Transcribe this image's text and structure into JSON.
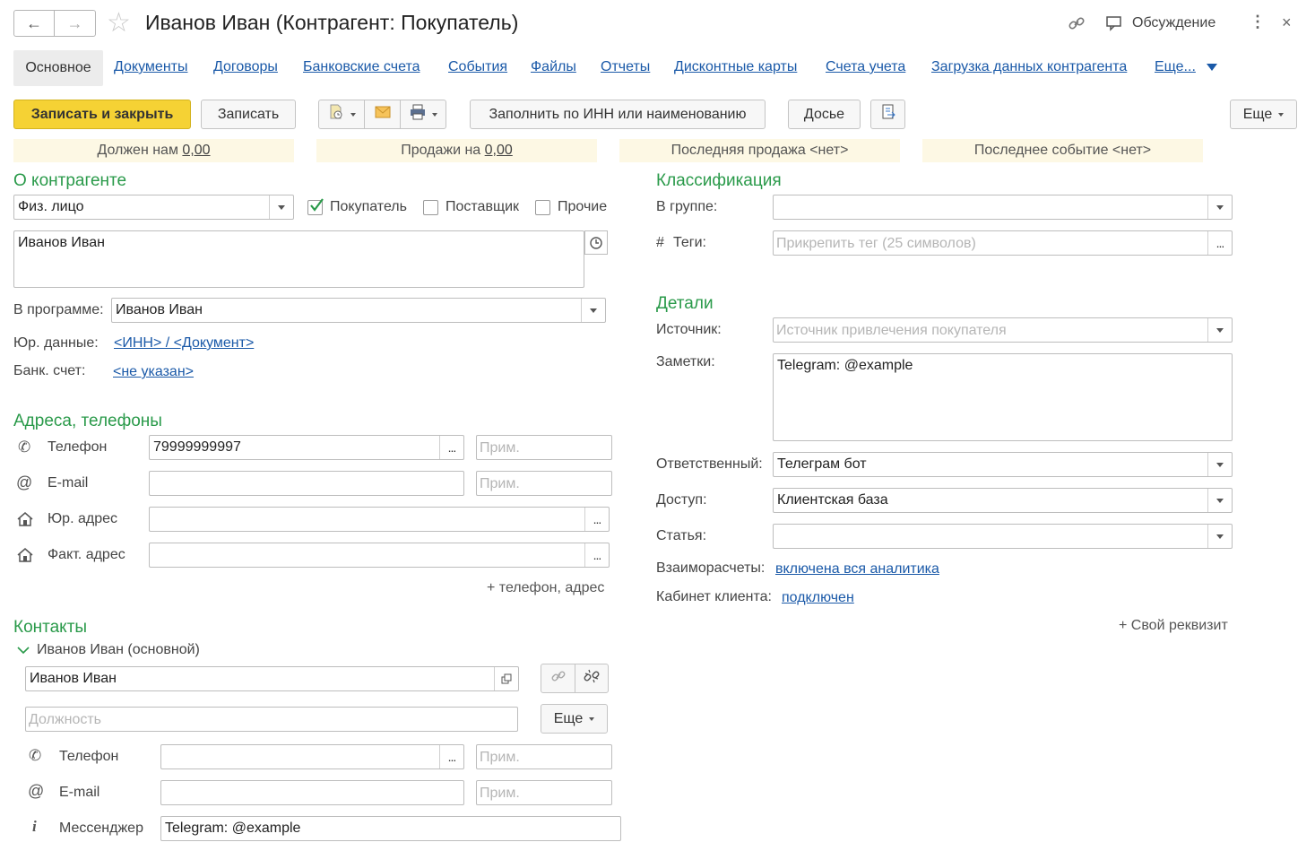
{
  "window": {
    "title": "Иванов Иван (Контрагент: Покупатель)",
    "discussion_label": "Обсуждение"
  },
  "tabs": {
    "active": "Основное",
    "items": [
      "Документы",
      "Договоры",
      "Банковские счета",
      "События",
      "Файлы",
      "Отчеты",
      "Дисконтные карты",
      "Счета учета",
      "Загрузка данных контрагента",
      "Еще..."
    ]
  },
  "toolbar": {
    "save_close": "Записать и закрыть",
    "save": "Записать",
    "fill_inn": "Заполнить по ИНН или наименованию",
    "dossier": "Досье",
    "more": "Еще"
  },
  "summary": {
    "owes_label": "Должен нам",
    "owes_value": "0,00",
    "sales_label": "Продажи на",
    "sales_value": "0,00",
    "last_sale": "Последняя продажа <нет>",
    "last_event": "Последнее событие <нет>"
  },
  "about": {
    "heading": "О контрагенте",
    "type_value": "Физ. лицо",
    "chk_buyer": "Покупатель",
    "chk_supplier": "Поставщик",
    "chk_other": "Прочие",
    "name_value": "Иванов Иван",
    "in_program_label": "В программе:",
    "in_program_value": "Иванов Иван",
    "legal_label": "Юр. данные:",
    "legal_link": "<ИНН> / <Документ>",
    "bank_label": "Банк. счет:",
    "bank_link": "<не указан>"
  },
  "addresses": {
    "heading": "Адреса, телефоны",
    "phone_label": "Телефон",
    "phone_value": "79999999997",
    "email_label": "E-mail",
    "legal_addr_label": "Юр. адрес",
    "fact_addr_label": "Факт. адрес",
    "note_placeholder": "Прим.",
    "add_link": "+ телефон, адрес"
  },
  "contacts": {
    "heading": "Контакты",
    "contact_title": "Иванов Иван (основной)",
    "name_value": "Иванов Иван",
    "position_placeholder": "Должность",
    "more": "Еще",
    "phone_label": "Телефон",
    "email_label": "E-mail",
    "messenger_label": "Мессенджер",
    "messenger_value": "Telegram: @example",
    "note_placeholder": "Прим."
  },
  "classification": {
    "heading": "Классификация",
    "group_label": "В группе:",
    "tags_label": "Теги:",
    "tags_hash": "#",
    "tags_placeholder": "Прикрепить тег (25 символов)"
  },
  "details": {
    "heading": "Детали",
    "source_label": "Источник:",
    "source_placeholder": "Источник привлечения покупателя",
    "notes_label": "Заметки:",
    "notes_value": "Telegram: @example",
    "responsible_label": "Ответственный:",
    "responsible_value": "Телеграм бот",
    "access_label": "Доступ:",
    "access_value": "Клиентская база",
    "article_label": "Статья:",
    "settlements_label": "Взаиморасчеты:",
    "settlements_link": "включена вся аналитика",
    "cabinet_label": "Кабинет клиента:",
    "cabinet_link": "подключен",
    "own_attr": "+ Свой реквизит"
  },
  "colors": {
    "accent_green": "#2a9a4a",
    "link_blue": "#1a59a8",
    "primary_button": "#f5d234",
    "summary_bg": "#fdf8e4"
  }
}
